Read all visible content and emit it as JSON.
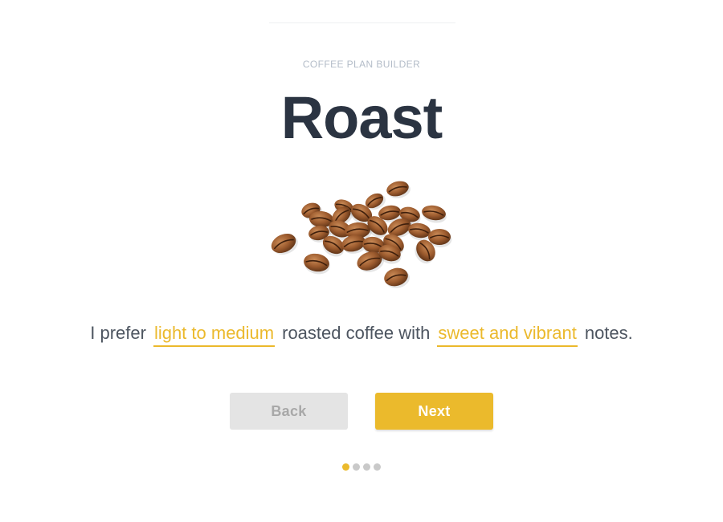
{
  "header": {
    "eyebrow": "COFFEE PLAN BUILDER",
    "title": "Roast"
  },
  "illustration": {
    "name": "coffee-beans"
  },
  "sentence": {
    "prefix": "I prefer",
    "roast_choice": "light to medium",
    "middle": "roasted coffee with",
    "notes_choice": "sweet and vibrant",
    "suffix": "notes."
  },
  "buttons": {
    "back_label": "Back",
    "next_label": "Next"
  },
  "pagination": {
    "total": 4,
    "current": 1
  },
  "colors": {
    "accent": "#ebba2c",
    "title": "#2b3442",
    "muted": "#b3bcc8",
    "back_bg": "#e4e4e4"
  }
}
